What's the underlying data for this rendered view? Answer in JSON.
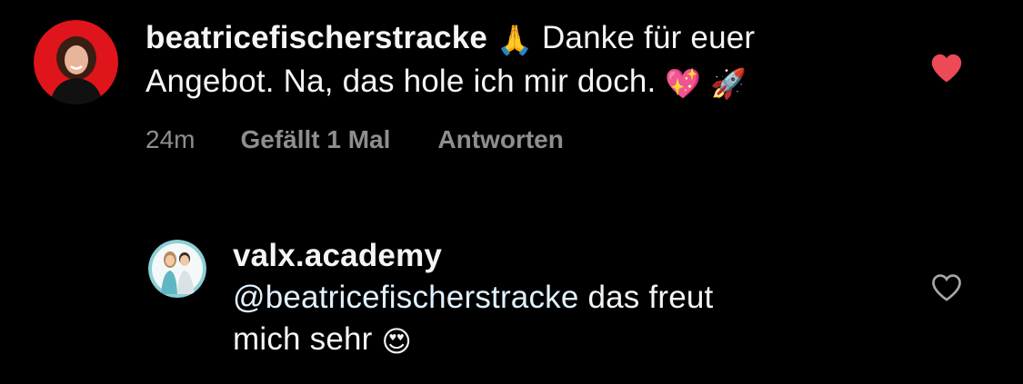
{
  "comments": [
    {
      "username": "beatricefischerstracke",
      "emoji_pray": "🙏",
      "text_line1_after": " Danke für euer",
      "text_line2": "Angebot. Na, das hole ich mir doch. ",
      "emoji_heart": "💖",
      "emoji_rocket": "🚀",
      "time": "24m",
      "likes_label": "Gefällt 1 Mal",
      "reply_label": "Antworten",
      "liked": true,
      "heart_color": "#ed4956",
      "avatar_bg": "#e0151b",
      "avatar_icon": "user-avatar-photo"
    },
    {
      "username": "valx.academy",
      "mention": "@beatricefischerstracke",
      "text_line1_after": " das freut",
      "text_line2": "mich sehr ",
      "emoji_eyes": "😍",
      "liked": false,
      "heart_color": "#a8a8a8",
      "avatar_bg": "#ffffff",
      "avatar_icon": "brand-avatar-photo"
    }
  ]
}
